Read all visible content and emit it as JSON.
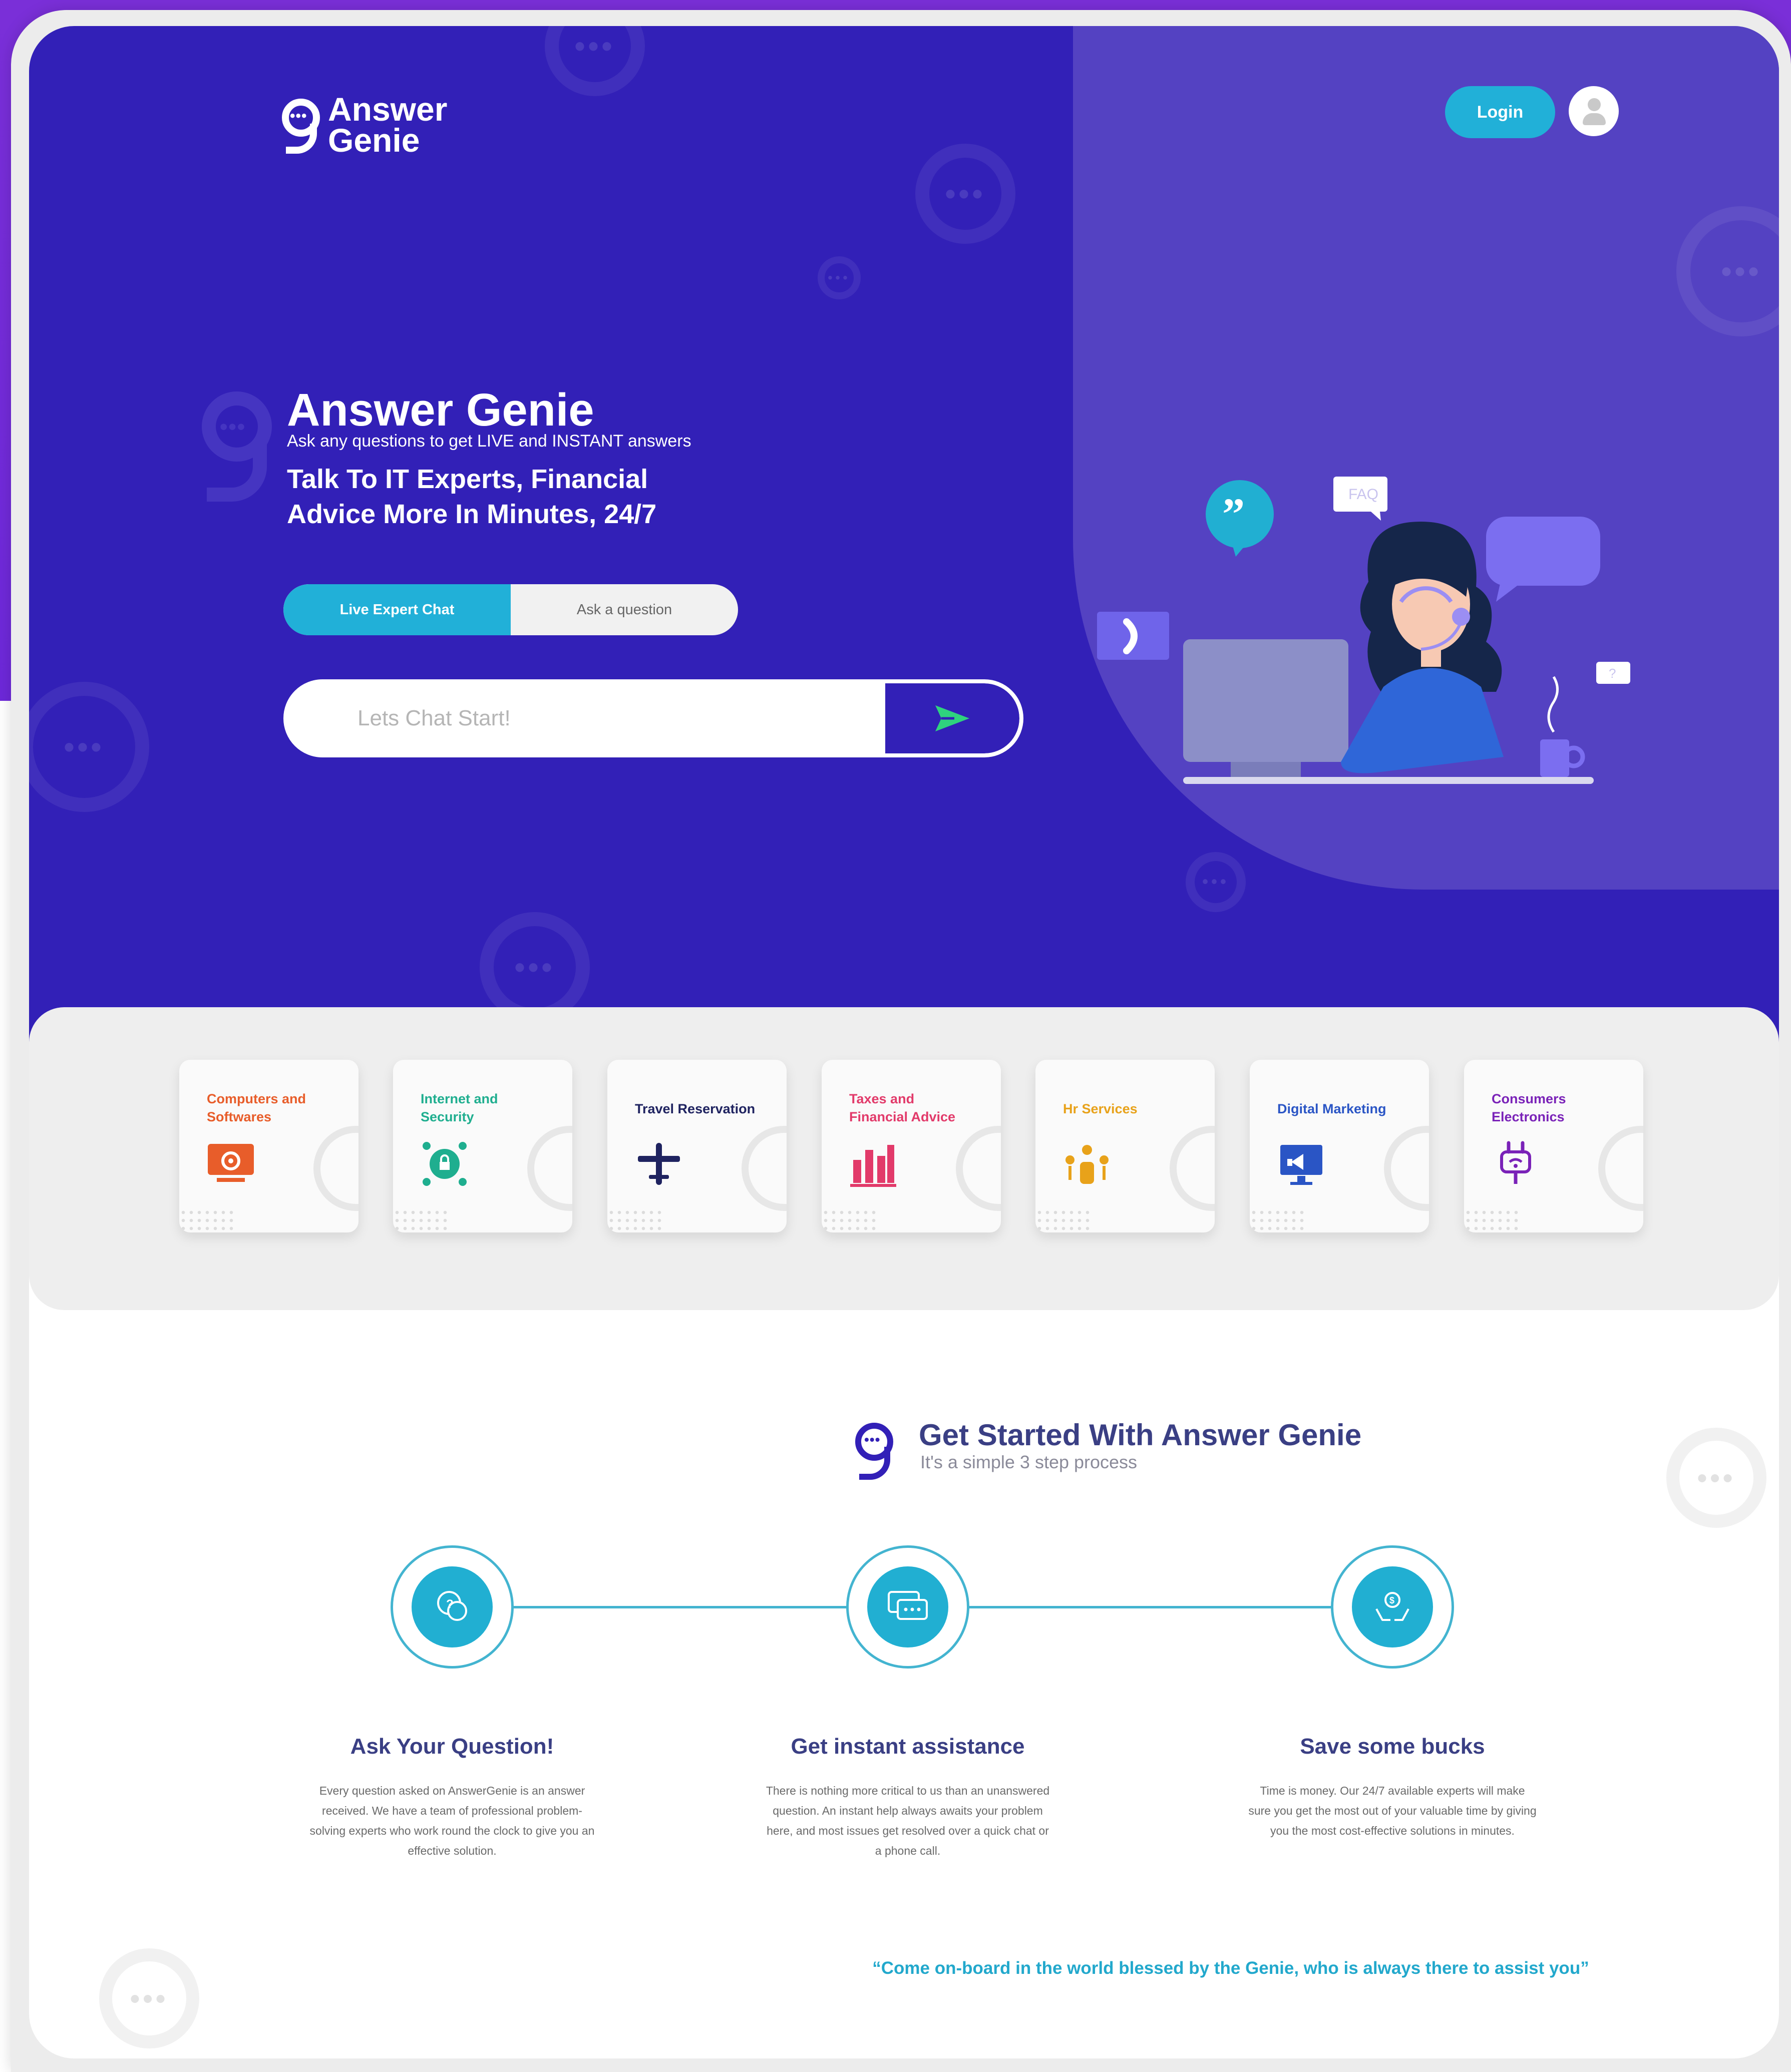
{
  "brand": {
    "logo_line1": "Answer",
    "logo_line2": "Genie"
  },
  "header": {
    "login_label": "Login"
  },
  "hero": {
    "title": "Answer Genie",
    "subtitle": "Ask any questions to get LIVE and  INSTANT answers",
    "tagline": "Talk To IT Experts, Financial Advice More In Minutes, 24/7",
    "toggle": {
      "active": "Live Expert Chat",
      "inactive": "Ask a question"
    },
    "chat": {
      "placeholder": "Lets Chat Start!"
    },
    "illustration": {
      "faq_bubble": "FAQ",
      "question_bubble": "?"
    }
  },
  "categories": [
    {
      "label": "Computers and Softwares",
      "color": "#e85d2a",
      "icon": "computer-gear-icon"
    },
    {
      "label": "Internet and Security",
      "color": "#1fae8f",
      "icon": "network-lock-icon"
    },
    {
      "label": "Travel Reservation",
      "color": "#1f2360",
      "icon": "airplane-icon"
    },
    {
      "label": "Taxes and Financial Advice",
      "color": "#e23a6a",
      "icon": "bar-chart-icon"
    },
    {
      "label": "Hr Services",
      "color": "#e8a21a",
      "icon": "people-network-icon"
    },
    {
      "label": "Digital Marketing",
      "color": "#2a55c5",
      "icon": "megaphone-monitor-icon"
    },
    {
      "label": "Consumers Electronics",
      "color": "#7a22b8",
      "icon": "plug-wifi-icon"
    }
  ],
  "get_started": {
    "title": "Get Started With Answer Genie",
    "subtitle": "It's a simple 3 step process",
    "steps": [
      {
        "title": "Ask Your Question!",
        "text": "Every question asked on AnswerGenie is an answer received. We have a team of professional problem-solving experts who work round the clock to give you an effective solution.",
        "icon": "question-chat-icon"
      },
      {
        "title": "Get instant assistance",
        "text": "There is nothing more critical to us than an unanswered question. An instant help always awaits your problem here, and most issues get resolved over a quick chat or a phone call.",
        "icon": "chat-bubbles-icon"
      },
      {
        "title": "Save some bucks",
        "text": "Time is money. Our 24/7 available experts will make sure you get the most out of your valuable time by giving you the most cost-effective solutions in minutes.",
        "icon": "hands-coin-icon"
      }
    ],
    "quote": "“Come on-board in the world blessed by the Genie, who is always there to assist you”"
  },
  "colors": {
    "hero_bg": "#3220b7",
    "hero_panel": "#5442c2",
    "accent": "#21b0d8",
    "heading": "#3a3f84"
  }
}
